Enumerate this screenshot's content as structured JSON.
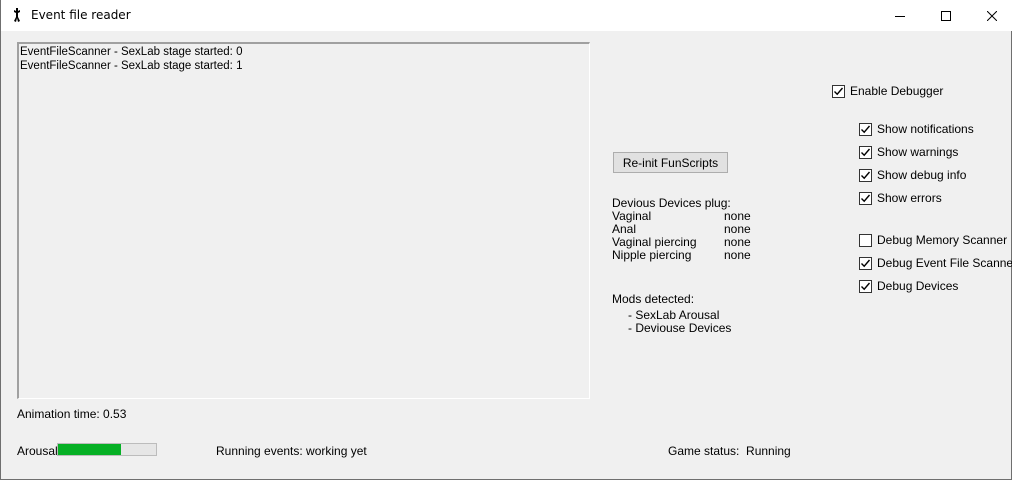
{
  "window": {
    "title": "Event file reader"
  },
  "log": {
    "lines": [
      "EventFileScanner - SexLab stage started: 0",
      "EventFileScanner - SexLab stage started: 1"
    ]
  },
  "status": {
    "animation_time": "Animation time: 0.53",
    "arousal_label": "Arousal",
    "arousal_level": 0.64,
    "running_events": "Running events: working yet",
    "game_status": "Game status:  Running"
  },
  "actions": {
    "reinit_label": "Re-init FunScripts"
  },
  "devious_devices": {
    "heading": "Devious Devices plug:",
    "rows": [
      {
        "slot": "Vaginal",
        "value": "none"
      },
      {
        "slot": "Anal",
        "value": "none"
      },
      {
        "slot": "Vaginal piercing",
        "value": "none"
      },
      {
        "slot": "Nipple piercing",
        "value": "none"
      }
    ]
  },
  "mods": {
    "heading": "Mods detected:",
    "items": [
      "- SexLab Arousal",
      "- Deviouse Devices"
    ]
  },
  "debug": {
    "enable": {
      "label": "Enable Debugger",
      "checked": true
    },
    "options": [
      {
        "label": "Show notifications",
        "checked": true
      },
      {
        "label": "Show warnings",
        "checked": true
      },
      {
        "label": "Show debug info",
        "checked": true
      },
      {
        "label": "Show errors",
        "checked": true
      },
      {
        "label": "Debug Memory Scanner",
        "checked": false
      },
      {
        "label": "Debug Event File Scanner",
        "checked": true
      },
      {
        "label": "Debug Devices",
        "checked": true
      }
    ]
  },
  "colors": {
    "progress_fill": "#06b025",
    "title_bg": "#ffffff",
    "client_bg": "#f0f0f0"
  }
}
